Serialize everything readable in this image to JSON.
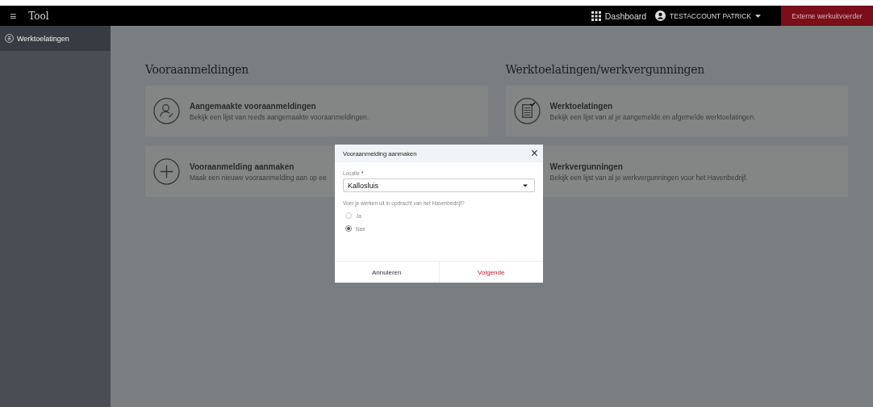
{
  "header": {
    "menu_icon": "≡",
    "title": "Tool",
    "dashboard": "Dashboard",
    "user": "TESTACCOUNT PATRICK",
    "role_button": "Externe werkuitvoerder"
  },
  "sidebar": {
    "items": [
      {
        "label": "Werktoelatingen",
        "selected": true
      }
    ]
  },
  "sections": [
    {
      "title": "Vooraanmeldingen",
      "cards": [
        {
          "kind": "person",
          "title": "Aangemaakte vooraanmeldingen",
          "description": "Bekijk een lijst van reeds aangemaakte vooraanmeldingen."
        },
        {
          "kind": "plus",
          "title": "Vooraanmelding aanmaken",
          "description": "Maak een nieuwe vooraanmelding aan op ee"
        }
      ]
    },
    {
      "title": "Werktoelatingen/werkvergunningen",
      "cards": [
        {
          "kind": "document",
          "title": "Werktoelatingen",
          "description": "Bekijk een lijst van al je aangemelde en afgemelde werktoelatingen."
        },
        {
          "kind": "none",
          "title": "Werkvergunningen",
          "description": "Bekijk een lijst van al je werkvergunningen voor het Havenbedrijf."
        }
      ]
    }
  ],
  "dialog": {
    "title": "Vooraanmelding aanmaken",
    "close": "×",
    "field_label": "Locatie",
    "required_mark": "*",
    "field_value": "Kallosluis",
    "question": "Voer je werken uit in opdracht van het Havenbedrijf?",
    "options": [
      {
        "label": "Ja",
        "selected": false
      },
      {
        "label": "Nee",
        "selected": true
      }
    ],
    "buttons": [
      {
        "label": "Annuleren",
        "kind": "cancel"
      },
      {
        "label": "Volgende",
        "kind": "primary"
      }
    ]
  }
}
